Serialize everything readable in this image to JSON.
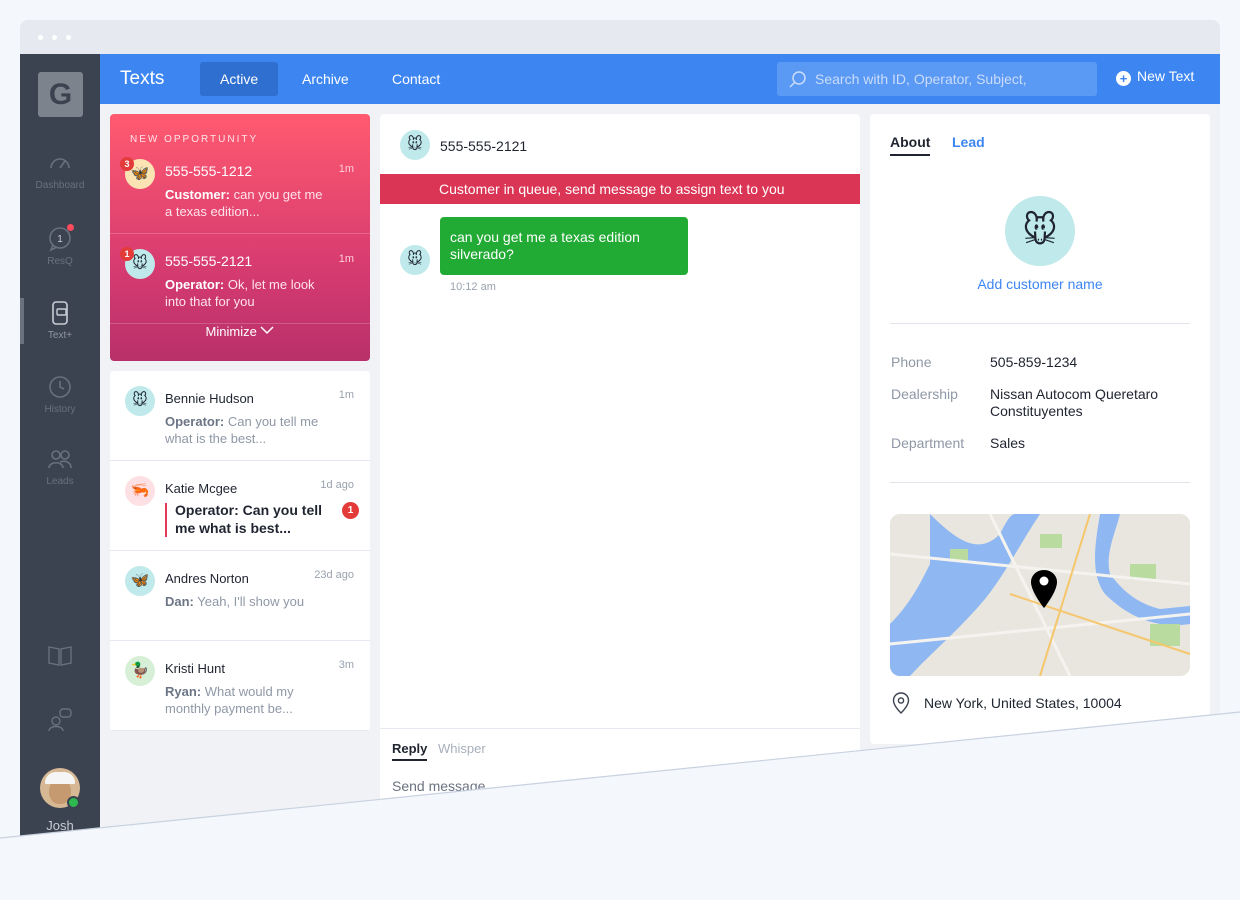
{
  "window": {
    "dots": 3
  },
  "sidebar": {
    "logo": "G",
    "items": [
      {
        "label": "Dashboard",
        "icon": "gauge-icon"
      },
      {
        "label": "ResQ",
        "icon": "chat-bubble-icon",
        "count": "1"
      },
      {
        "label": "Text+",
        "icon": "phone-text-icon"
      },
      {
        "label": "History",
        "icon": "clock-icon"
      },
      {
        "label": "Leads",
        "icon": "people-icon"
      },
      {
        "label": "",
        "icon": "book-icon"
      },
      {
        "label": "",
        "icon": "support-icon"
      }
    ],
    "user": {
      "name": "Josh"
    }
  },
  "header": {
    "title": "Texts",
    "tabs": [
      {
        "label": "Active"
      },
      {
        "label": "Archive"
      },
      {
        "label": "Contact"
      }
    ],
    "search_placeholder": "Search with ID, Operator, Subject,",
    "new_text_label": "New Text"
  },
  "opportunities": {
    "label": "NEW OPPORTUNITY",
    "items": [
      {
        "phone": "555-555-1212",
        "time": "1m",
        "sender": "Customer:",
        "text": "can you get me a texas edition...",
        "badge": "3",
        "avatar": "🦋"
      },
      {
        "phone": "555-555-2121",
        "time": "1m",
        "sender": "Operator:",
        "text": "Ok, let me look into that for you",
        "badge": "1",
        "avatar": "🐭"
      }
    ],
    "minimize_label": "Minimize"
  },
  "conversations": [
    {
      "name": "Bennie Hudson",
      "time": "1m",
      "sender": "Operator:",
      "text": "Can you tell me what is the best...",
      "avatar": "🐭"
    },
    {
      "name": "Katie Mcgee",
      "time": "1d ago",
      "text": "Operator: Can you tell me what is best...",
      "badge": "1",
      "avatar": "🦐"
    },
    {
      "name": "Andres Norton",
      "time": "23d ago",
      "sender": "Dan:",
      "text": "Yeah, I'll show you",
      "avatar": "🦋"
    },
    {
      "name": "Kristi Hunt",
      "time": "3m",
      "sender": "Ryan:",
      "text": "What would my monthly payment be...",
      "avatar": "🦆"
    }
  ],
  "chat": {
    "phone": "555-555-2121",
    "avatar": "🐭",
    "banner": "Customer in queue, send message to assign text to you",
    "messages": [
      {
        "text": "can you get me a texas edition silverado?",
        "time": "10:12 am"
      }
    ],
    "compose_tabs": [
      {
        "label": "Reply"
      },
      {
        "label": "Whisper"
      }
    ],
    "compose_placeholder": "Send message"
  },
  "details": {
    "tabs": [
      {
        "label": "About"
      },
      {
        "label": "Lead"
      }
    ],
    "avatar": "🐭",
    "add_name_label": "Add customer name",
    "fields": [
      {
        "label": "Phone",
        "value": "505-859-1234"
      },
      {
        "label": "Dealership",
        "value": "Nissan Autocom Queretaro Constituyentes"
      },
      {
        "label": "Department",
        "value": "Sales"
      }
    ],
    "location": "New York, United States, 10004"
  },
  "colors": {
    "accent": "#3d86f2",
    "sidebar": "#3b4250",
    "opportunity_top": "#ff5a70",
    "opportunity_bottom": "#b8306a",
    "banner": "#db3555",
    "bubble": "#22ab34"
  }
}
